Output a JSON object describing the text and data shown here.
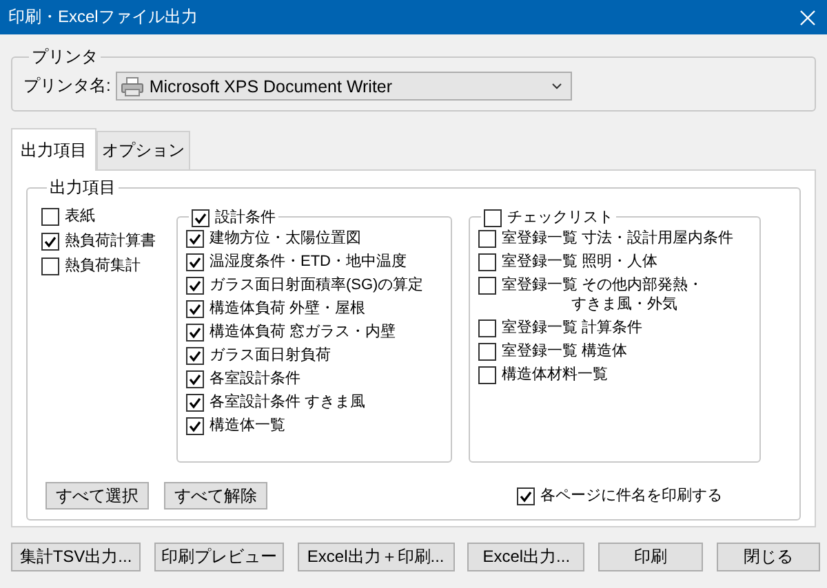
{
  "window": {
    "title": "印刷・Excelファイル出力"
  },
  "printer": {
    "group_label": "プリンタ",
    "field_label": "プリンタ名:",
    "value": "Microsoft XPS Document Writer"
  },
  "tabs": [
    {
      "label": "出力項目",
      "selected": true
    },
    {
      "label": "オプション",
      "selected": false
    }
  ],
  "output": {
    "label": "出力項目",
    "items": [
      {
        "label": "表紙",
        "checked": false
      },
      {
        "label": "熱負荷計算書",
        "checked": true
      },
      {
        "label": "熱負荷集計",
        "checked": false
      }
    ],
    "design": {
      "label": "設計条件",
      "checked": true,
      "items": [
        {
          "label": "建物方位・太陽位置図",
          "checked": true
        },
        {
          "label": "温湿度条件・ETD・地中温度",
          "checked": true
        },
        {
          "label": "ガラス面日射面積率(SG)の算定",
          "checked": true
        },
        {
          "label": "構造体負荷 外壁・屋根",
          "checked": true
        },
        {
          "label": "構造体負荷 窓ガラス・内壁",
          "checked": true
        },
        {
          "label": "ガラス面日射負荷",
          "checked": true
        },
        {
          "label": "各室設計条件",
          "checked": true
        },
        {
          "label": "各室設計条件 すきま風",
          "checked": true
        },
        {
          "label": "構造体一覧",
          "checked": true
        }
      ]
    },
    "checklist": {
      "label": "チェックリスト",
      "checked": false,
      "items": [
        {
          "label": "室登録一覧 寸法・設計用屋内条件",
          "checked": false
        },
        {
          "label": "室登録一覧 照明・人体",
          "checked": false
        },
        {
          "lines": [
            "室登録一覧 その他内部発熱・",
            "すきま風・外気"
          ],
          "checked": false
        },
        {
          "label": "室登録一覧 計算条件",
          "checked": false
        },
        {
          "label": "室登録一覧 構造体",
          "checked": false
        },
        {
          "label": "構造体材料一覧",
          "checked": false
        }
      ]
    },
    "buttons": [
      "すべて選択",
      "すべて解除"
    ],
    "print_title": {
      "label": "各ページに件名を印刷する",
      "checked": true
    }
  },
  "footer_buttons": [
    "集計TSV出力...",
    "印刷プレビュー",
    "Excel出力＋印刷...",
    "Excel出力...",
    "印刷",
    "閉じる"
  ]
}
